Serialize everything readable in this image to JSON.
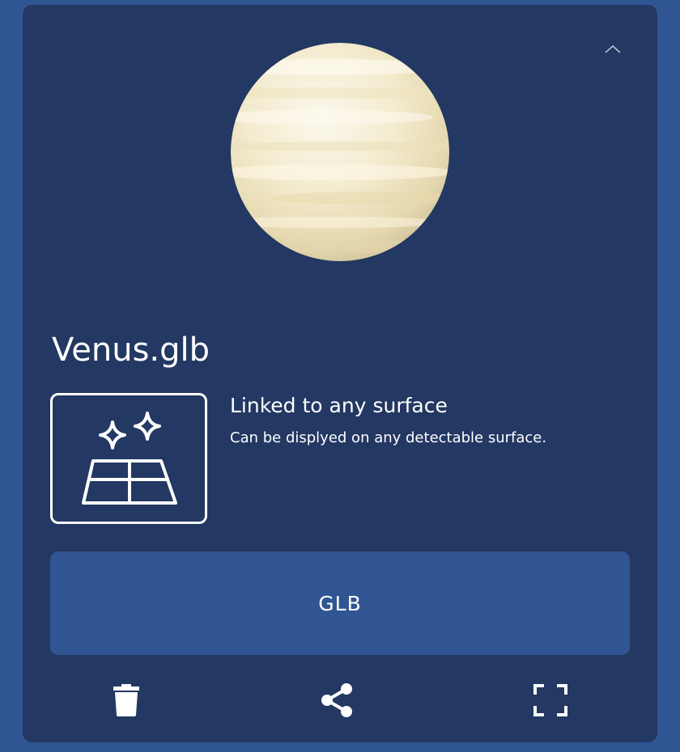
{
  "model": {
    "file_name": "Venus.glb",
    "preview_icon": "venus-planet-icon"
  },
  "placement": {
    "icon": "surface-sparkle-icon",
    "heading": "Linked to any surface",
    "description": "Can be displyed on any detectable surface."
  },
  "format_button": {
    "label": "GLB"
  },
  "actions": [
    {
      "icon": "trash-icon"
    },
    {
      "icon": "share-icon"
    },
    {
      "icon": "fullscreen-icon"
    }
  ],
  "colors": {
    "page_background": "#2f5592",
    "card_background": "#233862",
    "button_background": "#305592",
    "text": "#ffffff"
  }
}
